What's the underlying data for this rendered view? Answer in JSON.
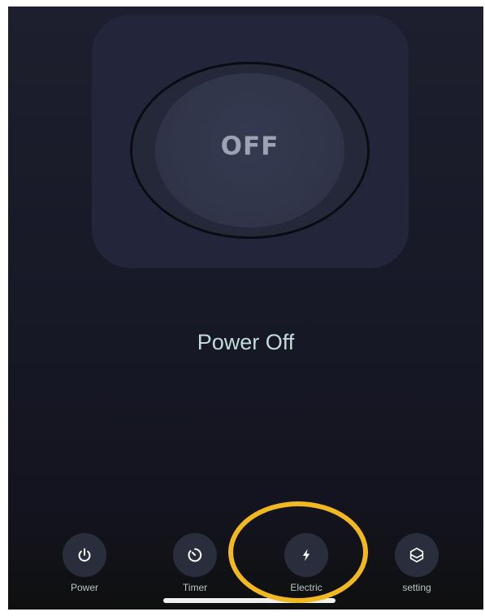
{
  "colors": {
    "background": "#1d1f2e",
    "panel": "#23263a",
    "knob": "#30354a",
    "status_text": "#c2dcd9",
    "tab_circle": "#2a2d3b",
    "highlight": "#f2b81f"
  },
  "power_button": {
    "label": "OFF"
  },
  "status": {
    "text": "Power Off"
  },
  "tabs": [
    {
      "label": "Power",
      "icon": "power-icon"
    },
    {
      "label": "Timer",
      "icon": "timer-icon"
    },
    {
      "label": "Electric",
      "icon": "lightning-icon"
    },
    {
      "label": "setting",
      "icon": "cube-icon"
    }
  ],
  "annotation": {
    "highlighted_tab": "Electric",
    "shape": "circle"
  }
}
